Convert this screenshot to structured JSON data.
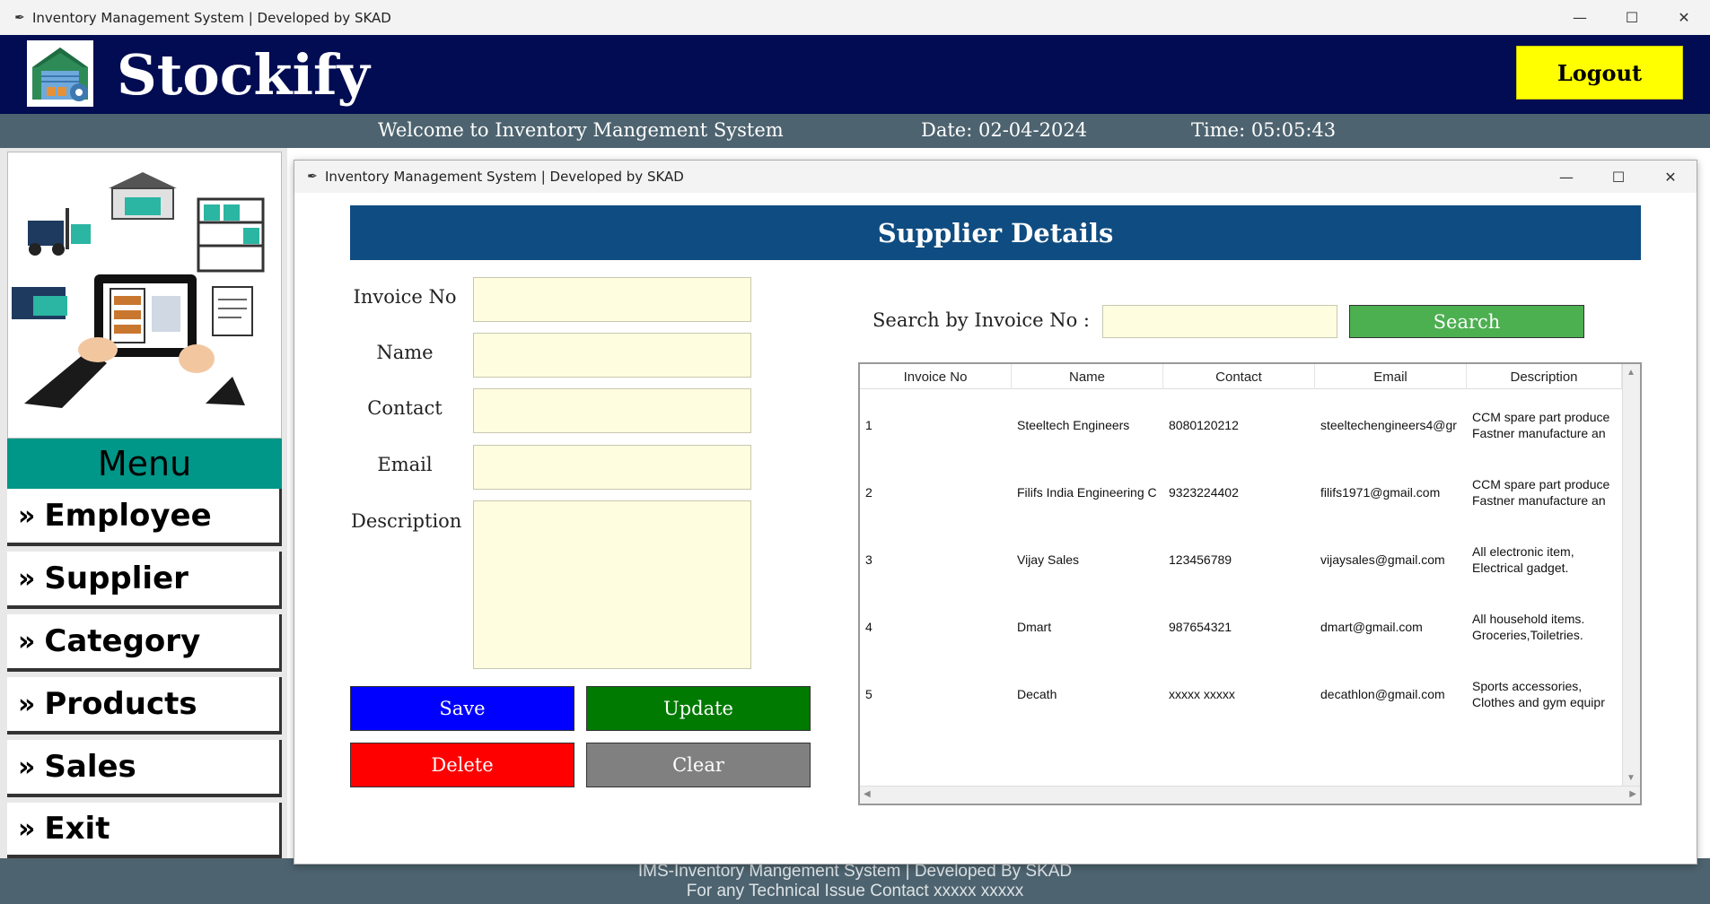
{
  "window": {
    "title": "Inventory Management System | Developed by SKAD",
    "feather_icon": "feather-icon",
    "minimize": "—",
    "maximize": "☐",
    "close": "✕"
  },
  "header": {
    "app_title": "Stockify",
    "logout_label": "Logout",
    "logo_icon": "warehouse-gear-icon",
    "colors": {
      "background": "#010c53",
      "logout_bg": "#ffff00"
    }
  },
  "subheader": {
    "welcome": "Welcome to Inventory Mangement System",
    "date": "Date: 02-04-2024",
    "time": "Time: 05:05:43"
  },
  "menu": {
    "heading": "Menu",
    "items": [
      {
        "label": "Employee"
      },
      {
        "label": "Supplier"
      },
      {
        "label": "Category"
      },
      {
        "label": "Products"
      },
      {
        "label": "Sales"
      },
      {
        "label": "Exit"
      }
    ],
    "chevron": "»"
  },
  "child_window": {
    "title": "Inventory Management System | Developed by SKAD",
    "heading": "Supplier Details",
    "form": {
      "invoice_label": "Invoice No",
      "name_label": "Name",
      "contact_label": "Contact",
      "email_label": "Email",
      "description_label": "Description",
      "invoice_value": "",
      "name_value": "",
      "contact_value": "",
      "email_value": "",
      "description_value": ""
    },
    "buttons": {
      "save": "Save",
      "update": "Update",
      "delete": "Delete",
      "clear": "Clear"
    },
    "search": {
      "label": "Search by Invoice No :",
      "value": "",
      "button": "Search"
    },
    "table": {
      "columns": [
        "Invoice No",
        "Name",
        "Contact",
        "Email",
        "Description"
      ],
      "rows": [
        {
          "invoice": "1",
          "name": "Steeltech Engineers",
          "contact": "8080120212",
          "email": "steeltechengineers4@gr",
          "desc1": "CCM spare part produce",
          "desc2": "Fastner manufacture an"
        },
        {
          "invoice": "2",
          "name": "Filifs India Engineering C",
          "contact": "9323224402",
          "email": "filifs1971@gmail.com",
          "desc1": "CCM spare part produce",
          "desc2": "Fastner manufacture an"
        },
        {
          "invoice": "3",
          "name": "Vijay Sales",
          "contact": "123456789",
          "email": "vijaysales@gmail.com",
          "desc1": "All electronic item,",
          "desc2": "Electrical gadget."
        },
        {
          "invoice": "4",
          "name": "Dmart",
          "contact": "987654321",
          "email": "dmart@gmail.com",
          "desc1": "All household items.",
          "desc2": "Groceries,Toiletries."
        },
        {
          "invoice": "5",
          "name": "Decath",
          "contact": "xxxxx xxxxx",
          "email": "decathlon@gmail.com",
          "desc1": "Sports accessories,",
          "desc2": "Clothes and gym equipr"
        }
      ]
    }
  },
  "footer": {
    "line1": "IMS-Inventory Mangement System | Developed By SKAD",
    "line2": "For any Technical Issue Contact xxxxx xxxxx"
  }
}
